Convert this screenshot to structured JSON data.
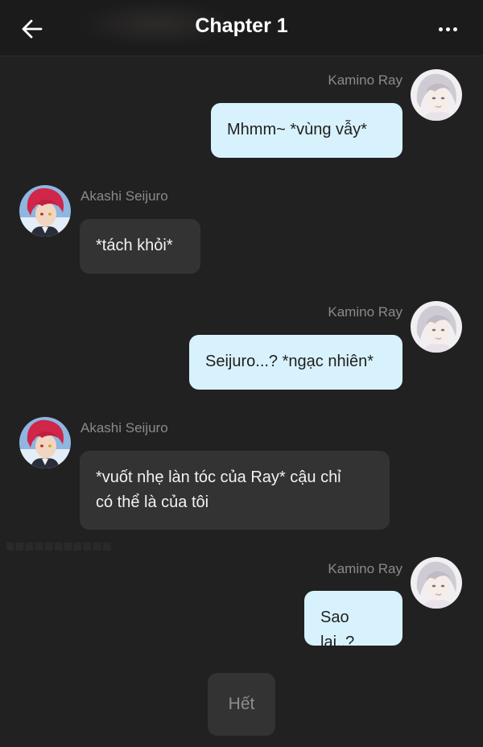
{
  "header": {
    "title": "Chapter 1",
    "back_icon": "arrow-left-icon",
    "more_icon": "more-horizontal-icon"
  },
  "messages": [
    {
      "sender": "Kamino Ray",
      "side": "right",
      "text": "Mhmm~ *vùng vẫy*"
    },
    {
      "sender": "Akashi Seijuro",
      "side": "left",
      "text": "*tách khỏi*"
    },
    {
      "sender": "Kamino Ray",
      "side": "right",
      "text": "Seijuro...? *ngạc nhiên*"
    },
    {
      "sender": "Akashi Seijuro",
      "side": "left",
      "text_line1": "*vuốt nhẹ làn tóc của Ray* cậu chỉ",
      "text_line2": "có thể là của tôi"
    },
    {
      "sender": "Kamino Ray",
      "side": "right",
      "text": "Sao lại..?"
    }
  ],
  "end_button": {
    "label": "Hết"
  },
  "colors": {
    "background": "#212121",
    "my_bubble": "#d8f2fd",
    "their_bubble": "#333333",
    "name_text": "#8a8a8a"
  }
}
